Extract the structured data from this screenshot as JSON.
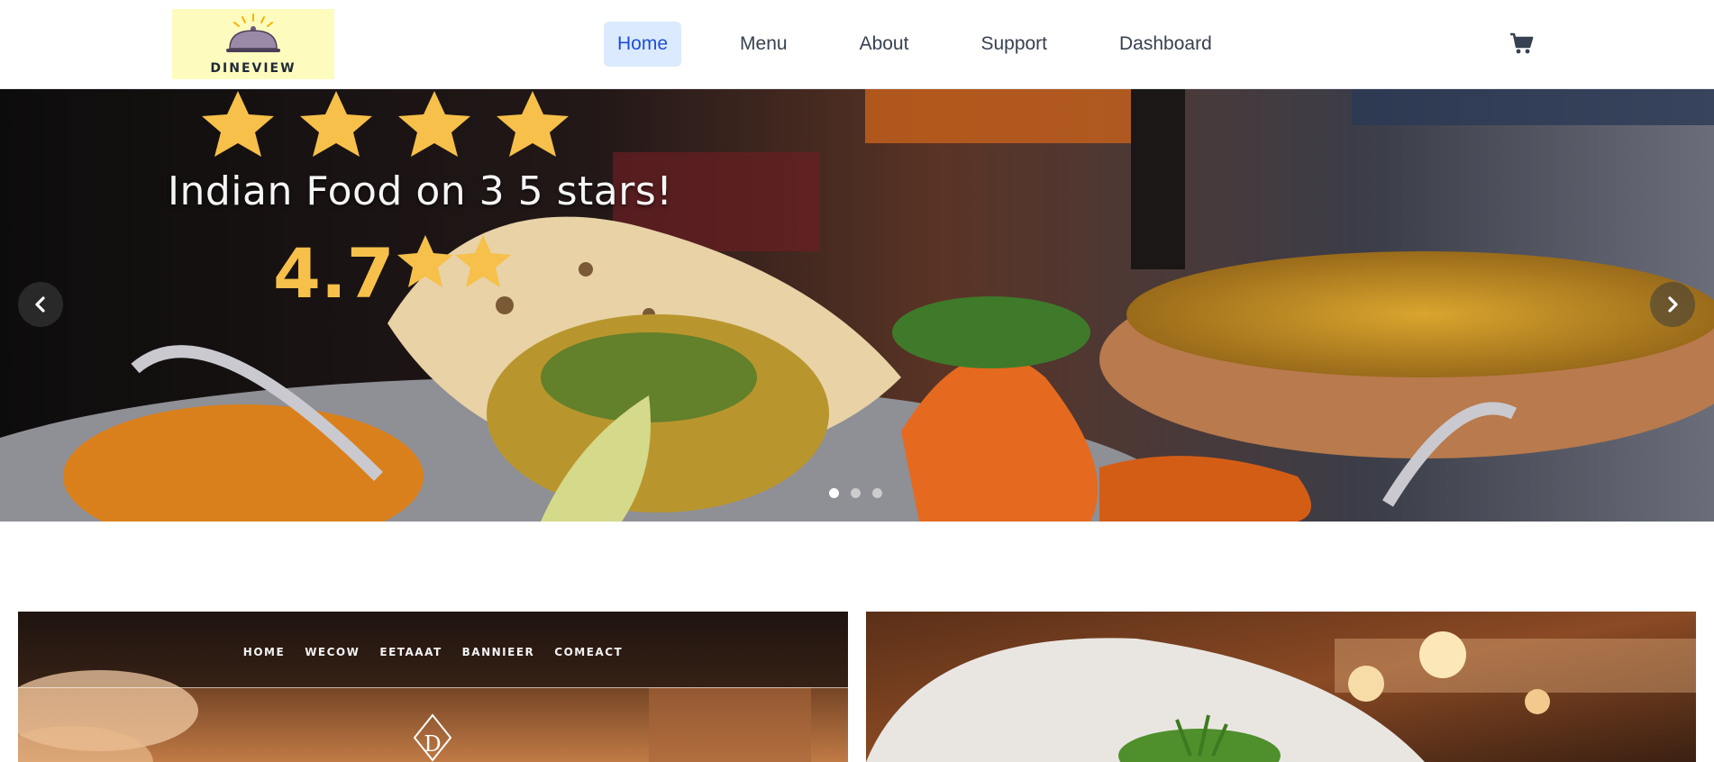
{
  "brand": {
    "name": "DINEVIEW",
    "logo_bg": "#fefbbf"
  },
  "nav": {
    "items": [
      "Home",
      "Menu",
      "About",
      "Support",
      "Dashboard"
    ],
    "active": "Home",
    "active_bg": "#dbeafe",
    "active_color": "#1d4ed8"
  },
  "cart": {
    "icon": "cart-icon"
  },
  "hero": {
    "headline": "Indian Food on 3 5 stars!",
    "rating": "4.7",
    "top_stars": 4,
    "rating_stars": 2,
    "star_color": "#f6c04a",
    "prev_icon": "chevron-left-icon",
    "next_icon": "chevron-right-icon",
    "slides": 3,
    "active_slide": 1
  },
  "cards": {
    "left": {
      "nav": [
        "HOME",
        "WECOW",
        "EETAAAT",
        "BANNIEER",
        "COMEACT"
      ]
    }
  }
}
